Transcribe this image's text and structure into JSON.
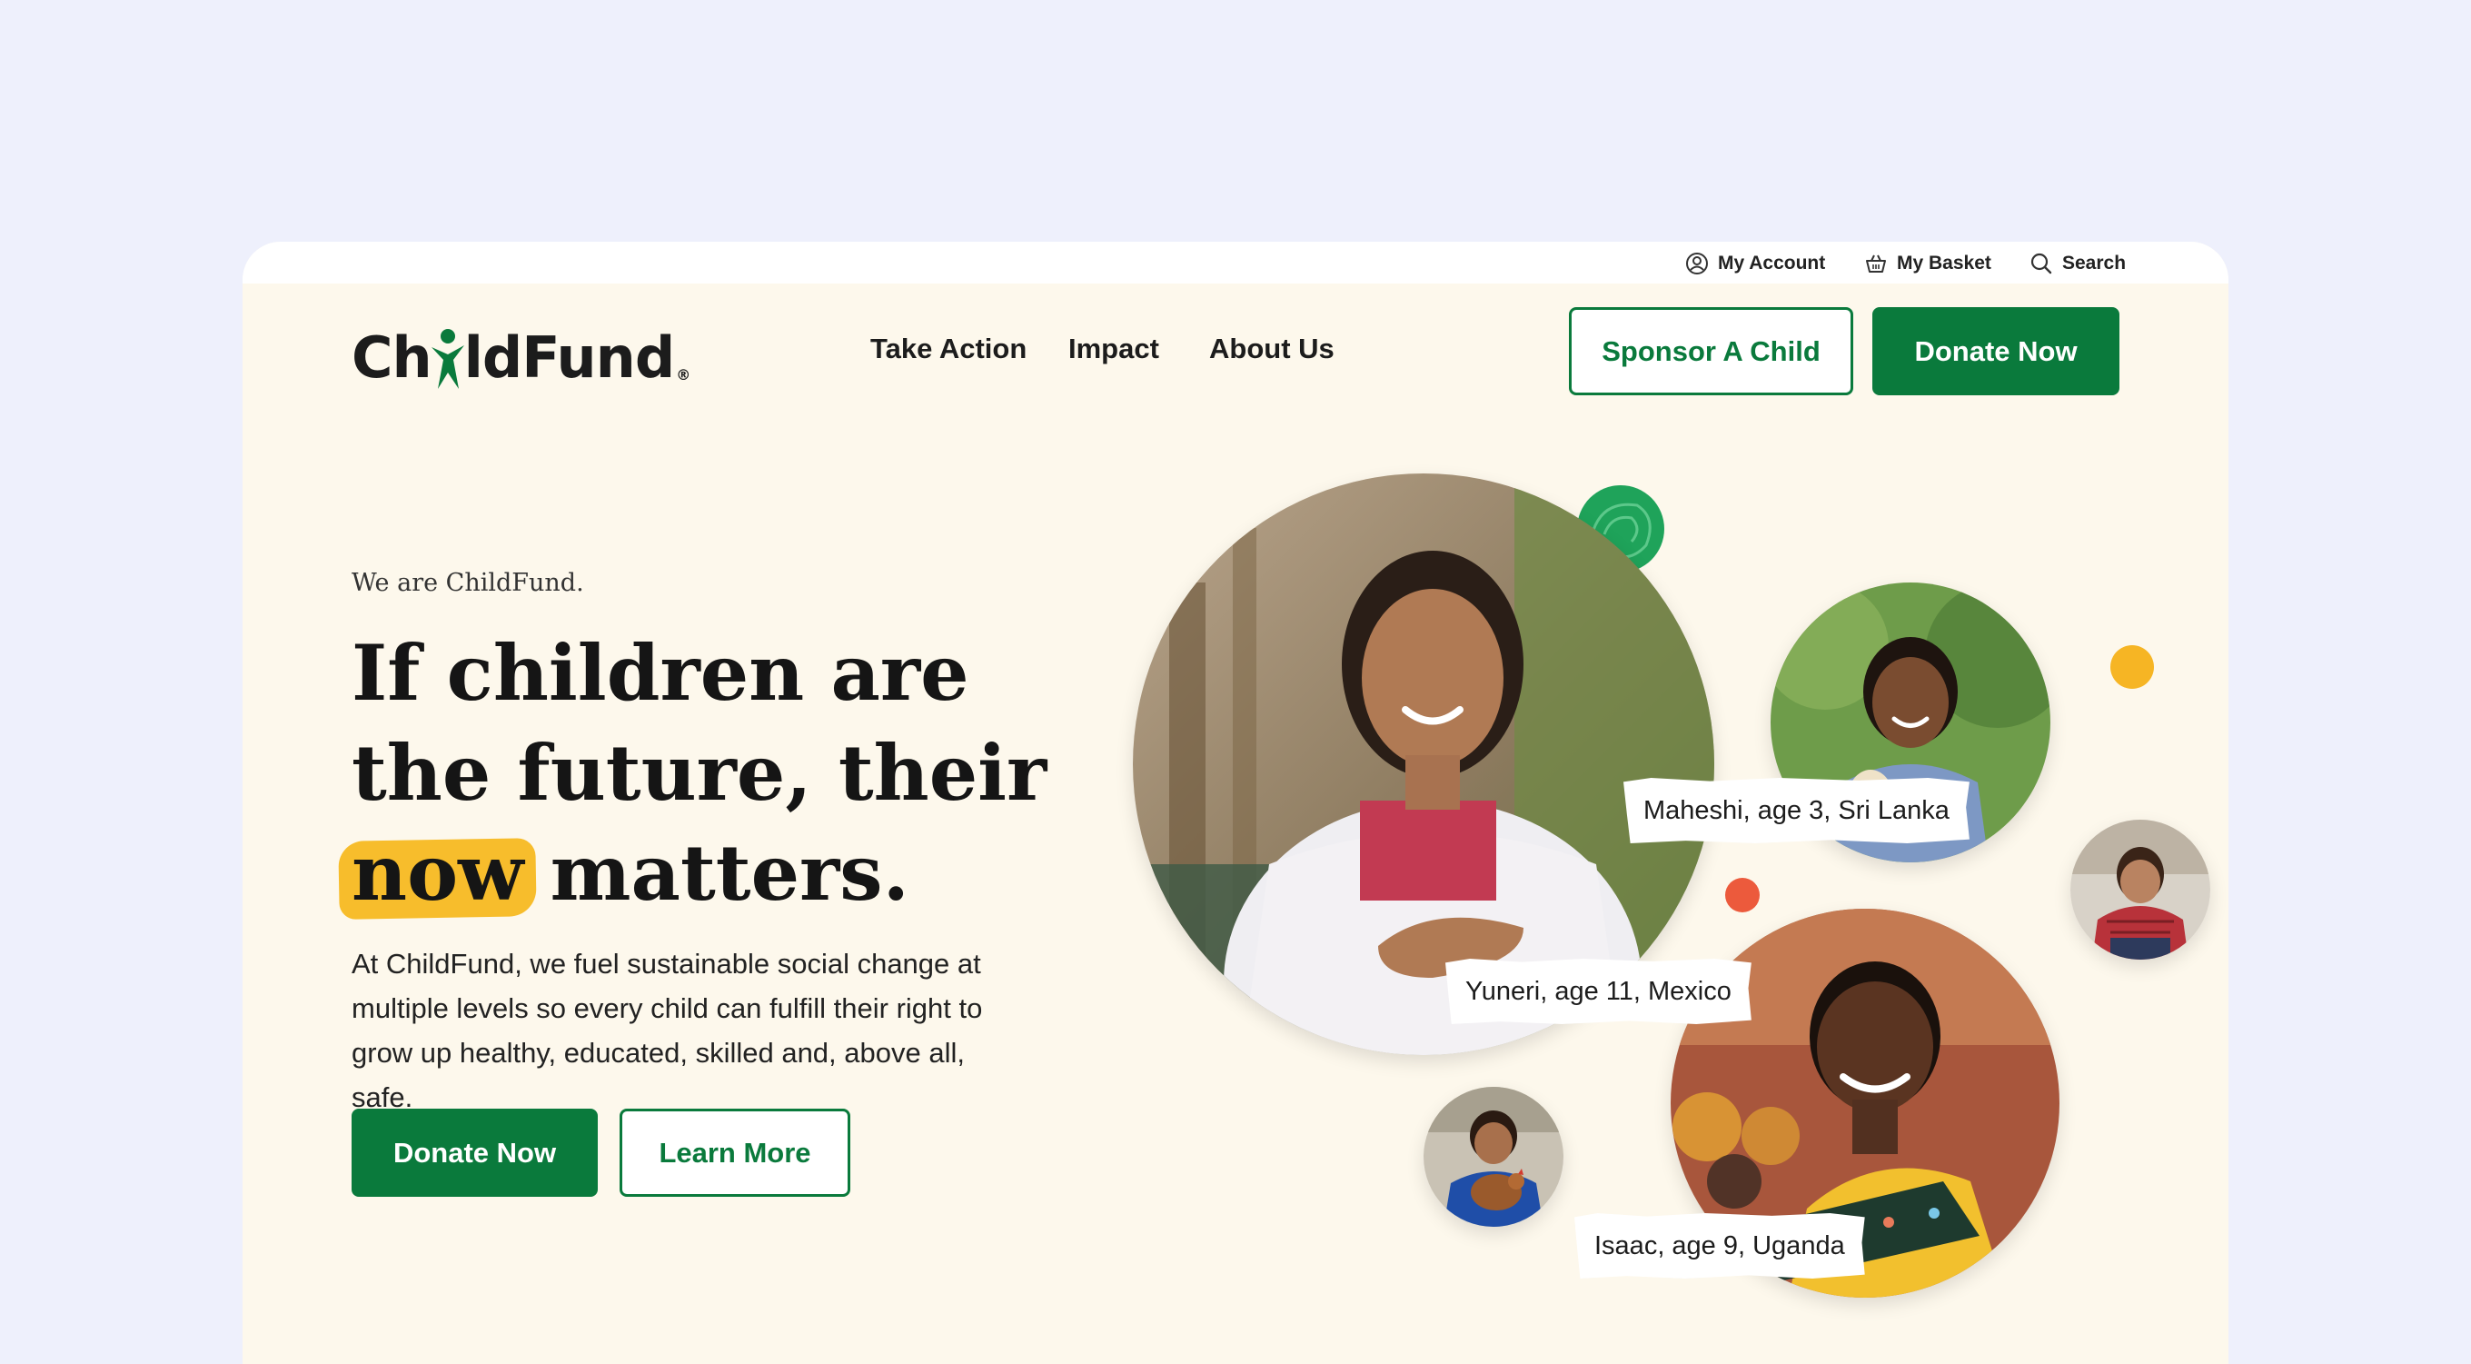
{
  "utility": {
    "account": "My Account",
    "basket": "My Basket",
    "search": "Search"
  },
  "logo": {
    "text_before": "Ch",
    "text_after": "ldFund",
    "reg": "®"
  },
  "nav": {
    "items": [
      "Take Action",
      "Impact",
      "About Us"
    ],
    "sponsor": "Sponsor A Child",
    "donate": "Donate Now"
  },
  "hero": {
    "eyebrow": "We are ChildFund.",
    "headline_before": "If children are the future, their ",
    "headline_highlight": "now",
    "headline_after": " matters.",
    "body": "At ChildFund, we fuel sustainable social change at multiple levels so every child can fulfill their right to grow up healthy, educated, skilled and, above all, safe.",
    "primary_cta": "Donate Now",
    "secondary_cta": "Learn More"
  },
  "captions": {
    "maheshi": "Maheshi, age 3, Sri Lanka",
    "yuneri": "Yuneri, age 11, Mexico",
    "isaac": "Isaac, age 9, Uganda"
  },
  "colors": {
    "brand_green": "#0a7a3c",
    "highlight_yellow": "#f7bd2c",
    "page_bg": "#fdf8ec",
    "outer_bg": "#eef0fc"
  }
}
